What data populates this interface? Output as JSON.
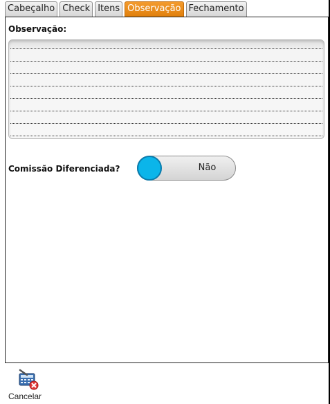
{
  "tabs": [
    {
      "label": "Cabeçalho",
      "active": false
    },
    {
      "label": "Check",
      "active": false
    },
    {
      "label": "Itens",
      "active": false
    },
    {
      "label": "Observação",
      "active": true
    },
    {
      "label": "Fechamento",
      "active": false
    }
  ],
  "observacao": {
    "label": "Observação:",
    "value": ""
  },
  "comissao": {
    "label": "Comissão Diferenciada?",
    "toggle_text": "Não",
    "toggle_on": false
  },
  "toolbar": {
    "cancel_label": "Cancelar",
    "cancel_icon": "calculator-cancel-icon"
  },
  "colors": {
    "accent_tab": "#e88a12",
    "toggle_knob": "#0bb5ea"
  }
}
